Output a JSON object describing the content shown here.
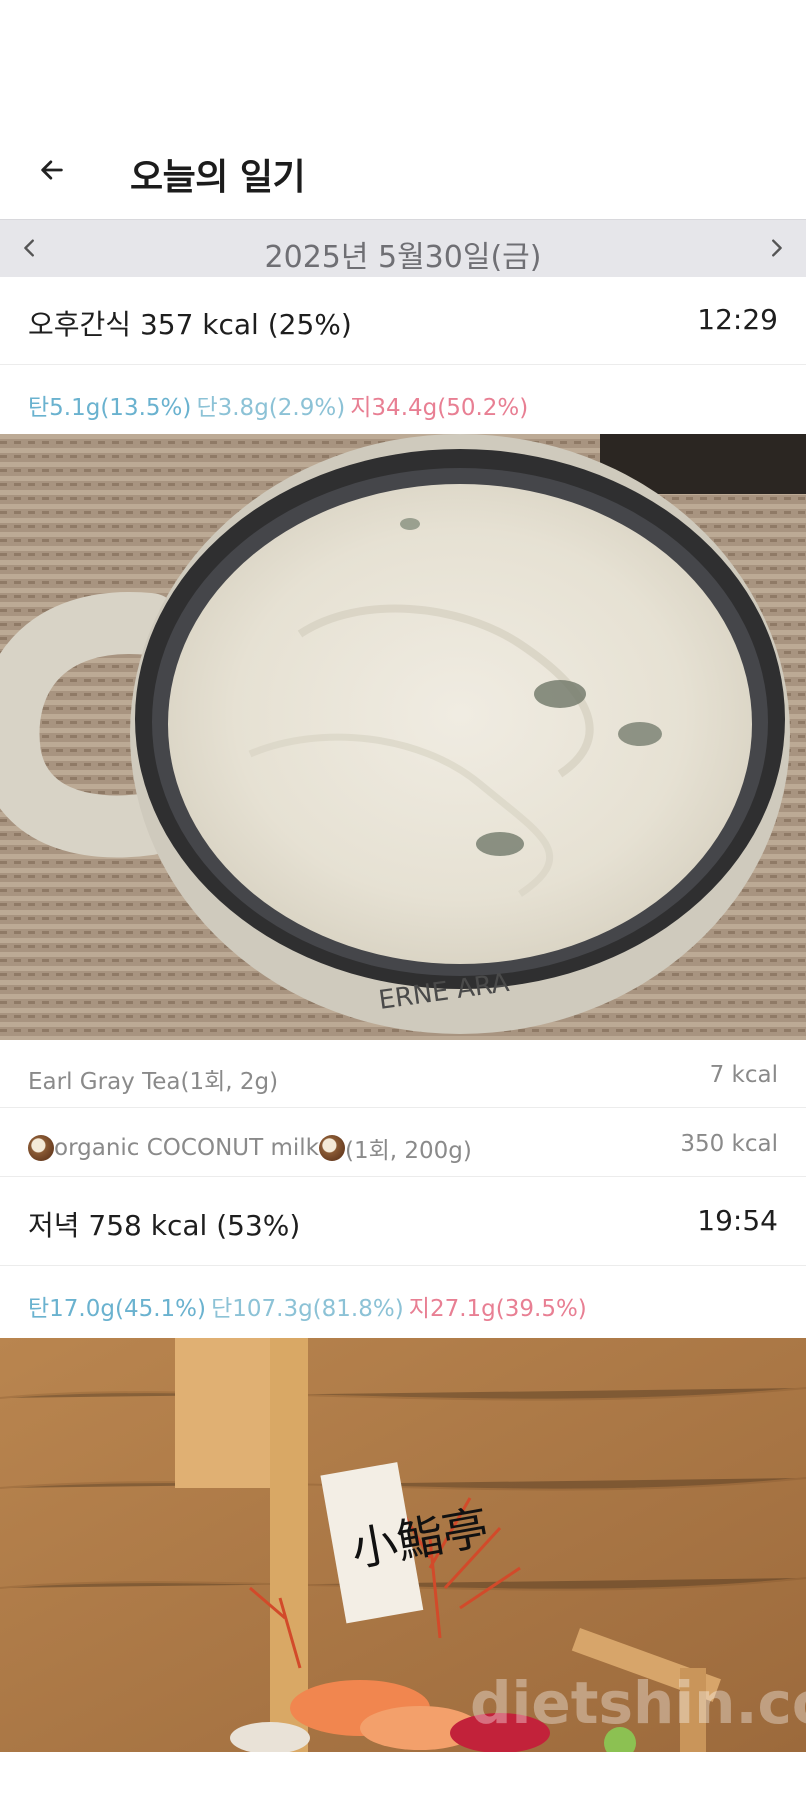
{
  "header": {
    "title": "오늘의 일기"
  },
  "date_nav": {
    "date": "2025년 5월30일(금)"
  },
  "meals": [
    {
      "title": "오후간식 357 kcal (25%)",
      "time": "12:29",
      "macros": {
        "carb": "탄5.1g(13.5%)",
        "protein": "단3.8g(2.9%)",
        "fat": "지34.4g(50.2%)"
      },
      "foods": [
        {
          "name": "Earl Gray Tea(1회, 2g)",
          "kcal": "7 kcal"
        },
        {
          "name": " organic COCONUT milk",
          "suffix": "(1회, 200g)",
          "kcal": "350 kcal"
        }
      ]
    },
    {
      "title": "저녁 758 kcal (53%)",
      "time": "19:54",
      "macros": {
        "carb": "탄17.0g(45.1%)",
        "protein": "단107.3g(81.8%)",
        "fat": "지27.1g(39.5%)"
      }
    }
  ],
  "colors": {
    "carb": "#6ab2cf",
    "protein": "#8cc2d6",
    "fat": "#e87f93",
    "date_bar": "#e6e6ea"
  },
  "icons": {
    "back": "arrow-left-icon",
    "prev": "chevron-left-icon",
    "next": "chevron-right-icon",
    "coconut": "coconut-icon"
  },
  "photos": {
    "dinner_sign": "小鮨亭",
    "watermark": "dietshin.com"
  }
}
